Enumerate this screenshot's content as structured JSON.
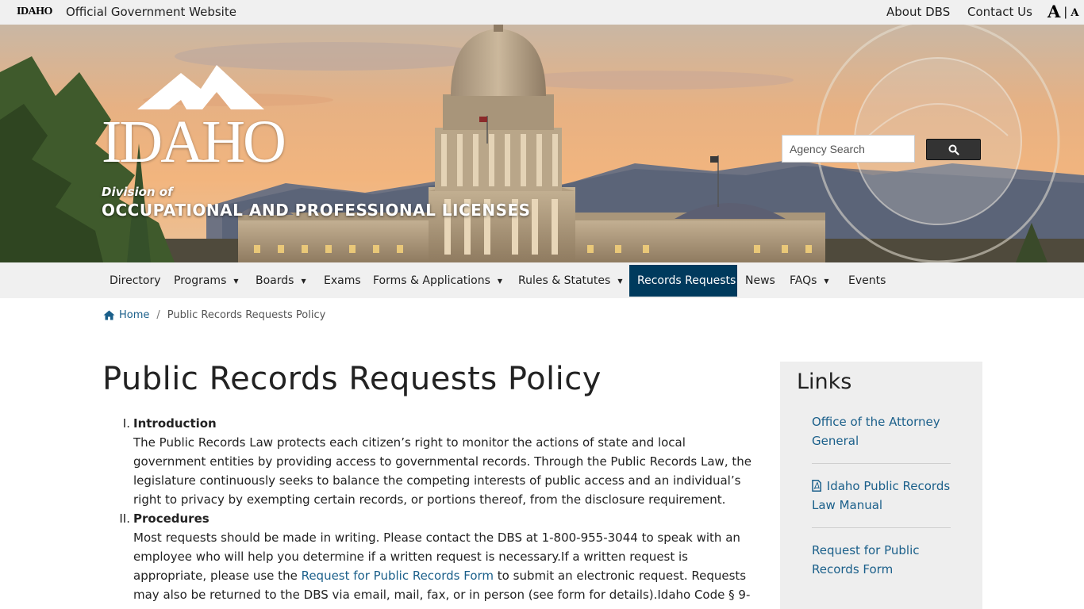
{
  "topbar": {
    "idaho_mini": "IDAHO",
    "official_text": "Official Government Website",
    "links": [
      {
        "label": "About DBS"
      },
      {
        "label": "Contact Us"
      }
    ],
    "text_size_large": "A",
    "text_size_separator": "|",
    "text_size_small": "A"
  },
  "banner": {
    "logo_word": "IDAHO",
    "division_of": "Division of",
    "agency_name": "OCCUPATIONAL AND PROFESSIONAL LICENSES",
    "search_placeholder": "Agency Search",
    "search_icon": "magnifier-icon"
  },
  "nav": {
    "items": [
      {
        "label": "Directory",
        "dropdown": false
      },
      {
        "label": "Programs",
        "dropdown": true
      },
      {
        "label": "Boards",
        "dropdown": true
      },
      {
        "label": "Exams",
        "dropdown": false
      },
      {
        "label": "Forms & Applications",
        "dropdown": true
      },
      {
        "label": "Rules & Statutes",
        "dropdown": true
      },
      {
        "label": "Records Requests",
        "dropdown": false,
        "active": true
      },
      {
        "label": "News",
        "dropdown": false
      },
      {
        "label": "FAQs",
        "dropdown": true
      },
      {
        "label": "Events",
        "dropdown": false
      }
    ],
    "caret": "▼",
    "active_color": "#003a5d"
  },
  "breadcrumb": {
    "home": "Home",
    "separator": "/",
    "current": "Public Records Requests Policy",
    "home_icon": "home-icon"
  },
  "main": {
    "title": "Public Records Requests Policy",
    "sections": [
      {
        "number": "I.",
        "heading": "Introduction",
        "body": "The Public Records Law protects each citizen’s right to monitor the actions of state and local government entities by providing access to governmental records. Through the Public Records Law, the legislature continuously seeks to balance the competing interests of public access and an individual’s right to privacy by exempting certain records, or portions thereof, from the disclosure requirement."
      },
      {
        "number": "II.",
        "heading": "Procedures",
        "body_before_link": "Most requests should be made in writing. Please contact the DBS at 1-800-955-3044 to speak with an employee who will help you determine if a written request is necessary.If a written request is appropriate, please use the ",
        "link_text": "Request for Public Records Form",
        "body_after_link": " to submit an electronic request. Requests may also be returned to the DBS via email, mail, fax, or in person (see form for details).Idaho Code § 9-"
      }
    ]
  },
  "sidebar": {
    "title": "Links",
    "links": [
      {
        "label": "Office of the Attorney General",
        "icon": null
      },
      {
        "label": "Idaho Public Records Law Manual",
        "icon": "pdf-file-icon"
      },
      {
        "label": "Request for Public Records Form",
        "icon": null
      }
    ]
  },
  "colors": {
    "link": "#1a5f8a",
    "nav_active": "#003a5d",
    "topbar_bg": "#f0f0f0",
    "sidebar_bg": "#eeeeee"
  }
}
